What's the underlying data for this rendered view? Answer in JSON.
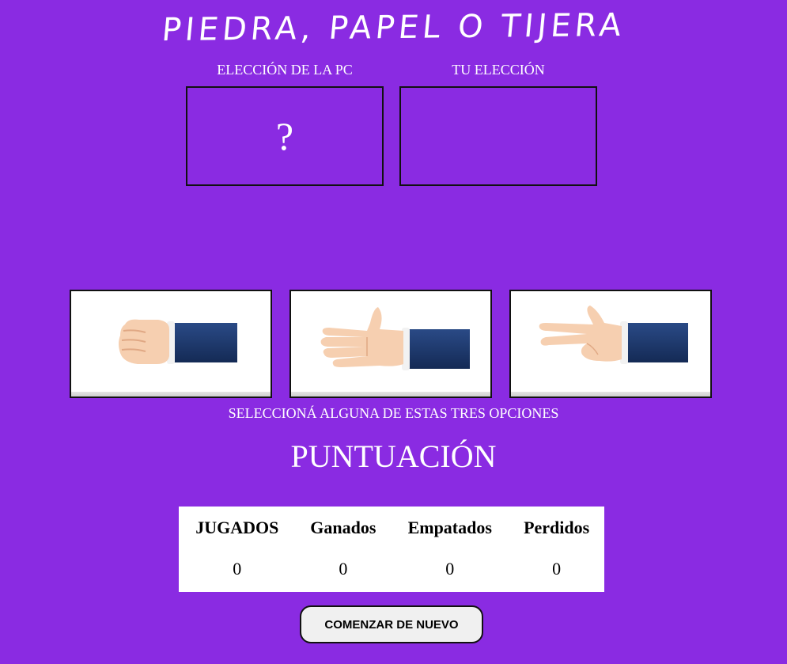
{
  "title": "PIEDRA, PAPEL O TIJERA",
  "pc_choice": {
    "label": "ELECCIÓN DE LA PC",
    "value": "?"
  },
  "user_choice": {
    "label": "TU ELECCIÓN",
    "value": ""
  },
  "options": [
    {
      "name": "piedra",
      "icon": "rock-hand-icon"
    },
    {
      "name": "papel",
      "icon": "paper-hand-icon"
    },
    {
      "name": "tijera",
      "icon": "scissors-hand-icon"
    }
  ],
  "instruction": "SELECCIONÁ ALGUNA DE ESTAS TRES OPCIONES",
  "score": {
    "title": "PUNTUACIÓN",
    "headers": [
      "JUGADOS",
      "Ganados",
      "Empatados",
      "Perdidos"
    ],
    "values": [
      "0",
      "0",
      "0",
      "0"
    ]
  },
  "reset_button": "COMENZAR DE NUEVO",
  "colors": {
    "background": "#8a2be2",
    "sleeve": "#1f3a6e",
    "skin": "#f6cfb0"
  }
}
